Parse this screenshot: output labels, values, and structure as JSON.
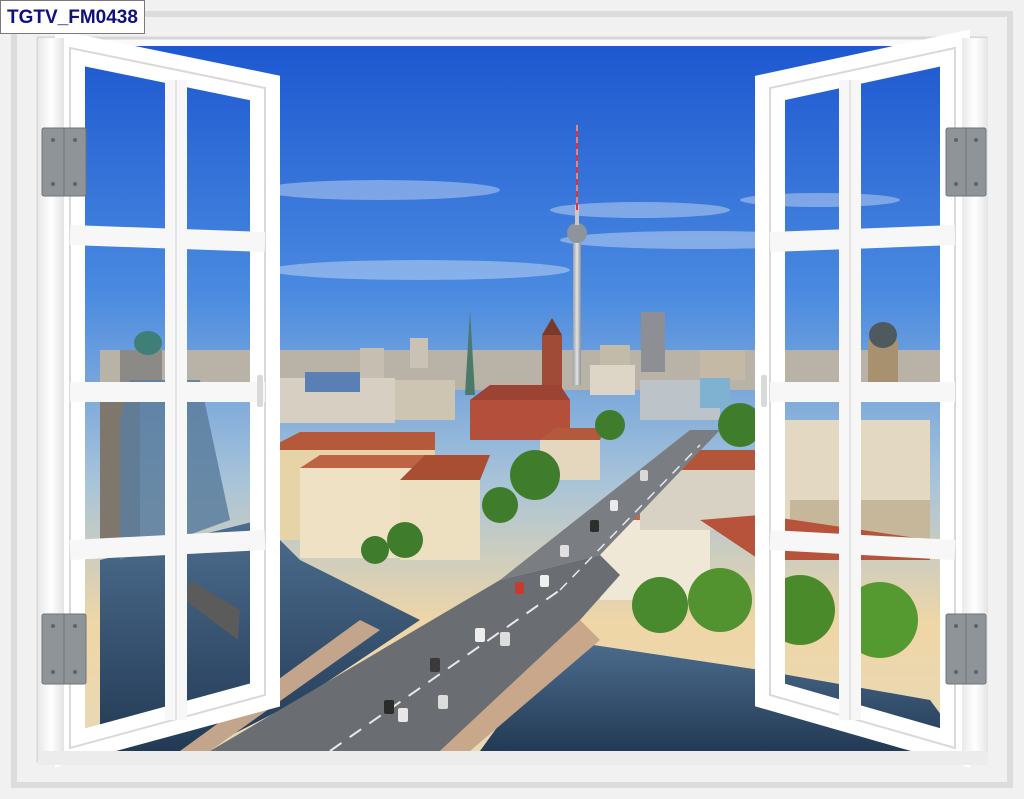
{
  "product_code": "TGTV_FM0438",
  "scene": {
    "subject": "window-view-city-skyline",
    "colors": {
      "sky_top": "#1f5fd6",
      "sky_bottom": "#f2d6a2",
      "river": "#2f4f78",
      "frame": "#ffffff",
      "hinge": "#8f9499",
      "roof": "#b4593a"
    }
  }
}
